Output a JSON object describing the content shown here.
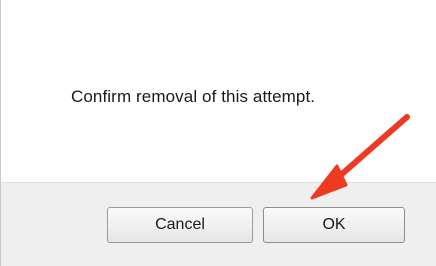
{
  "dialog": {
    "message": "Confirm removal of this attempt.",
    "buttons": {
      "cancel_label": "Cancel",
      "ok_label": "OK"
    }
  },
  "annotation": {
    "type": "arrow",
    "points_to": "ok-button",
    "color": "#ee3a22"
  }
}
